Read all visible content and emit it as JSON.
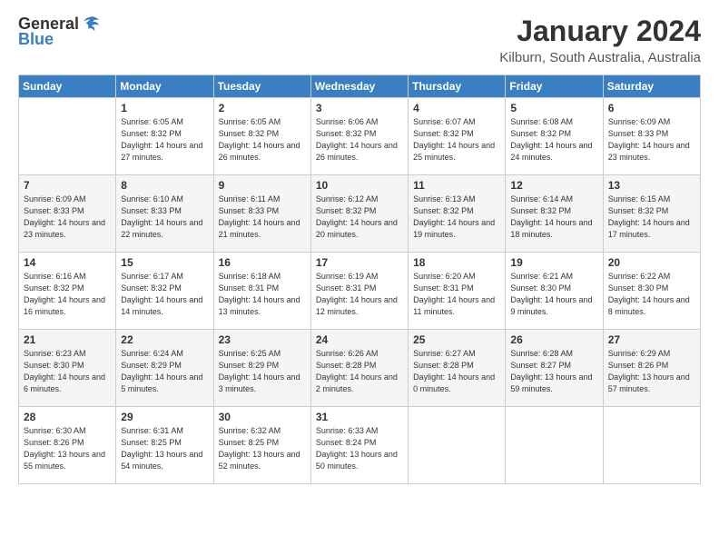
{
  "logo": {
    "line1": "General",
    "line2": "Blue"
  },
  "title": "January 2024",
  "location": "Kilburn, South Australia, Australia",
  "days_of_week": [
    "Sunday",
    "Monday",
    "Tuesday",
    "Wednesday",
    "Thursday",
    "Friday",
    "Saturday"
  ],
  "weeks": [
    [
      {
        "day": "",
        "sunrise": "",
        "sunset": "",
        "daylight": ""
      },
      {
        "day": "1",
        "sunrise": "Sunrise: 6:05 AM",
        "sunset": "Sunset: 8:32 PM",
        "daylight": "Daylight: 14 hours and 27 minutes."
      },
      {
        "day": "2",
        "sunrise": "Sunrise: 6:05 AM",
        "sunset": "Sunset: 8:32 PM",
        "daylight": "Daylight: 14 hours and 26 minutes."
      },
      {
        "day": "3",
        "sunrise": "Sunrise: 6:06 AM",
        "sunset": "Sunset: 8:32 PM",
        "daylight": "Daylight: 14 hours and 26 minutes."
      },
      {
        "day": "4",
        "sunrise": "Sunrise: 6:07 AM",
        "sunset": "Sunset: 8:32 PM",
        "daylight": "Daylight: 14 hours and 25 minutes."
      },
      {
        "day": "5",
        "sunrise": "Sunrise: 6:08 AM",
        "sunset": "Sunset: 8:32 PM",
        "daylight": "Daylight: 14 hours and 24 minutes."
      },
      {
        "day": "6",
        "sunrise": "Sunrise: 6:09 AM",
        "sunset": "Sunset: 8:33 PM",
        "daylight": "Daylight: 14 hours and 23 minutes."
      }
    ],
    [
      {
        "day": "7",
        "sunrise": "Sunrise: 6:09 AM",
        "sunset": "Sunset: 8:33 PM",
        "daylight": "Daylight: 14 hours and 23 minutes."
      },
      {
        "day": "8",
        "sunrise": "Sunrise: 6:10 AM",
        "sunset": "Sunset: 8:33 PM",
        "daylight": "Daylight: 14 hours and 22 minutes."
      },
      {
        "day": "9",
        "sunrise": "Sunrise: 6:11 AM",
        "sunset": "Sunset: 8:33 PM",
        "daylight": "Daylight: 14 hours and 21 minutes."
      },
      {
        "day": "10",
        "sunrise": "Sunrise: 6:12 AM",
        "sunset": "Sunset: 8:32 PM",
        "daylight": "Daylight: 14 hours and 20 minutes."
      },
      {
        "day": "11",
        "sunrise": "Sunrise: 6:13 AM",
        "sunset": "Sunset: 8:32 PM",
        "daylight": "Daylight: 14 hours and 19 minutes."
      },
      {
        "day": "12",
        "sunrise": "Sunrise: 6:14 AM",
        "sunset": "Sunset: 8:32 PM",
        "daylight": "Daylight: 14 hours and 18 minutes."
      },
      {
        "day": "13",
        "sunrise": "Sunrise: 6:15 AM",
        "sunset": "Sunset: 8:32 PM",
        "daylight": "Daylight: 14 hours and 17 minutes."
      }
    ],
    [
      {
        "day": "14",
        "sunrise": "Sunrise: 6:16 AM",
        "sunset": "Sunset: 8:32 PM",
        "daylight": "Daylight: 14 hours and 16 minutes."
      },
      {
        "day": "15",
        "sunrise": "Sunrise: 6:17 AM",
        "sunset": "Sunset: 8:32 PM",
        "daylight": "Daylight: 14 hours and 14 minutes."
      },
      {
        "day": "16",
        "sunrise": "Sunrise: 6:18 AM",
        "sunset": "Sunset: 8:31 PM",
        "daylight": "Daylight: 14 hours and 13 minutes."
      },
      {
        "day": "17",
        "sunrise": "Sunrise: 6:19 AM",
        "sunset": "Sunset: 8:31 PM",
        "daylight": "Daylight: 14 hours and 12 minutes."
      },
      {
        "day": "18",
        "sunrise": "Sunrise: 6:20 AM",
        "sunset": "Sunset: 8:31 PM",
        "daylight": "Daylight: 14 hours and 11 minutes."
      },
      {
        "day": "19",
        "sunrise": "Sunrise: 6:21 AM",
        "sunset": "Sunset: 8:30 PM",
        "daylight": "Daylight: 14 hours and 9 minutes."
      },
      {
        "day": "20",
        "sunrise": "Sunrise: 6:22 AM",
        "sunset": "Sunset: 8:30 PM",
        "daylight": "Daylight: 14 hours and 8 minutes."
      }
    ],
    [
      {
        "day": "21",
        "sunrise": "Sunrise: 6:23 AM",
        "sunset": "Sunset: 8:30 PM",
        "daylight": "Daylight: 14 hours and 6 minutes."
      },
      {
        "day": "22",
        "sunrise": "Sunrise: 6:24 AM",
        "sunset": "Sunset: 8:29 PM",
        "daylight": "Daylight: 14 hours and 5 minutes."
      },
      {
        "day": "23",
        "sunrise": "Sunrise: 6:25 AM",
        "sunset": "Sunset: 8:29 PM",
        "daylight": "Daylight: 14 hours and 3 minutes."
      },
      {
        "day": "24",
        "sunrise": "Sunrise: 6:26 AM",
        "sunset": "Sunset: 8:28 PM",
        "daylight": "Daylight: 14 hours and 2 minutes."
      },
      {
        "day": "25",
        "sunrise": "Sunrise: 6:27 AM",
        "sunset": "Sunset: 8:28 PM",
        "daylight": "Daylight: 14 hours and 0 minutes."
      },
      {
        "day": "26",
        "sunrise": "Sunrise: 6:28 AM",
        "sunset": "Sunset: 8:27 PM",
        "daylight": "Daylight: 13 hours and 59 minutes."
      },
      {
        "day": "27",
        "sunrise": "Sunrise: 6:29 AM",
        "sunset": "Sunset: 8:26 PM",
        "daylight": "Daylight: 13 hours and 57 minutes."
      }
    ],
    [
      {
        "day": "28",
        "sunrise": "Sunrise: 6:30 AM",
        "sunset": "Sunset: 8:26 PM",
        "daylight": "Daylight: 13 hours and 55 minutes."
      },
      {
        "day": "29",
        "sunrise": "Sunrise: 6:31 AM",
        "sunset": "Sunset: 8:25 PM",
        "daylight": "Daylight: 13 hours and 54 minutes."
      },
      {
        "day": "30",
        "sunrise": "Sunrise: 6:32 AM",
        "sunset": "Sunset: 8:25 PM",
        "daylight": "Daylight: 13 hours and 52 minutes."
      },
      {
        "day": "31",
        "sunrise": "Sunrise: 6:33 AM",
        "sunset": "Sunset: 8:24 PM",
        "daylight": "Daylight: 13 hours and 50 minutes."
      },
      {
        "day": "",
        "sunrise": "",
        "sunset": "",
        "daylight": ""
      },
      {
        "day": "",
        "sunrise": "",
        "sunset": "",
        "daylight": ""
      },
      {
        "day": "",
        "sunrise": "",
        "sunset": "",
        "daylight": ""
      }
    ]
  ]
}
